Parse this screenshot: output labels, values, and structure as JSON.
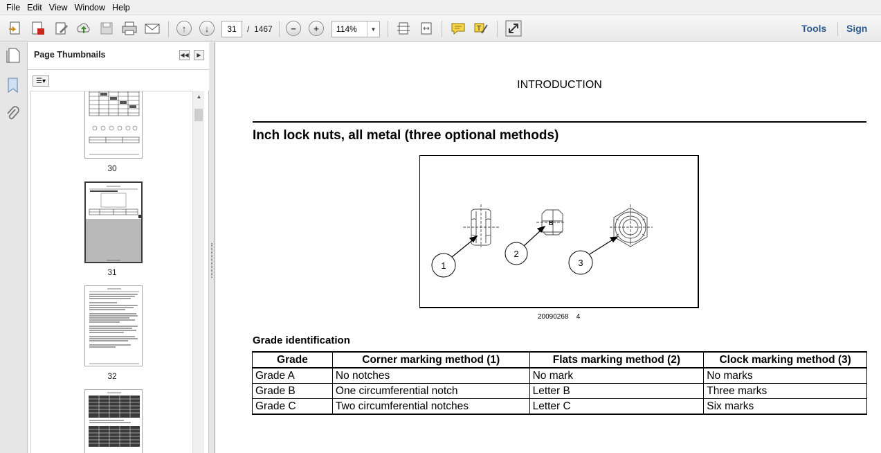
{
  "menu": [
    "File",
    "Edit",
    "View",
    "Window",
    "Help"
  ],
  "toolbar": {
    "current_page": "31",
    "page_separator": "/",
    "total_pages": "1467",
    "zoom": "114%",
    "tools_label": "Tools",
    "sign_label": "Sign"
  },
  "panel": {
    "title": "Page Thumbnails",
    "thumbnails": [
      {
        "label": "30"
      },
      {
        "label": "31"
      },
      {
        "label": "32"
      },
      {
        "label": ""
      }
    ]
  },
  "document": {
    "header": "INTRODUCTION",
    "section_title": "Inch lock nuts, all metal (three optional methods)",
    "figure": {
      "callouts": [
        "1",
        "2",
        "3"
      ],
      "nut2_letter": "B",
      "caption_id": "20090268",
      "caption_num": "4"
    },
    "grade_heading": "Grade identification",
    "table": {
      "headers": [
        "Grade",
        "Corner marking method (1)",
        "Flats marking method (2)",
        "Clock marking method (3)"
      ],
      "rows": [
        [
          "Grade A",
          "No notches",
          "No mark",
          "No marks"
        ],
        [
          "Grade B",
          "One circumferential notch",
          "Letter B",
          "Three marks"
        ],
        [
          "Grade C",
          "Two circumferential notches",
          "Letter C",
          "Six marks"
        ]
      ]
    }
  }
}
